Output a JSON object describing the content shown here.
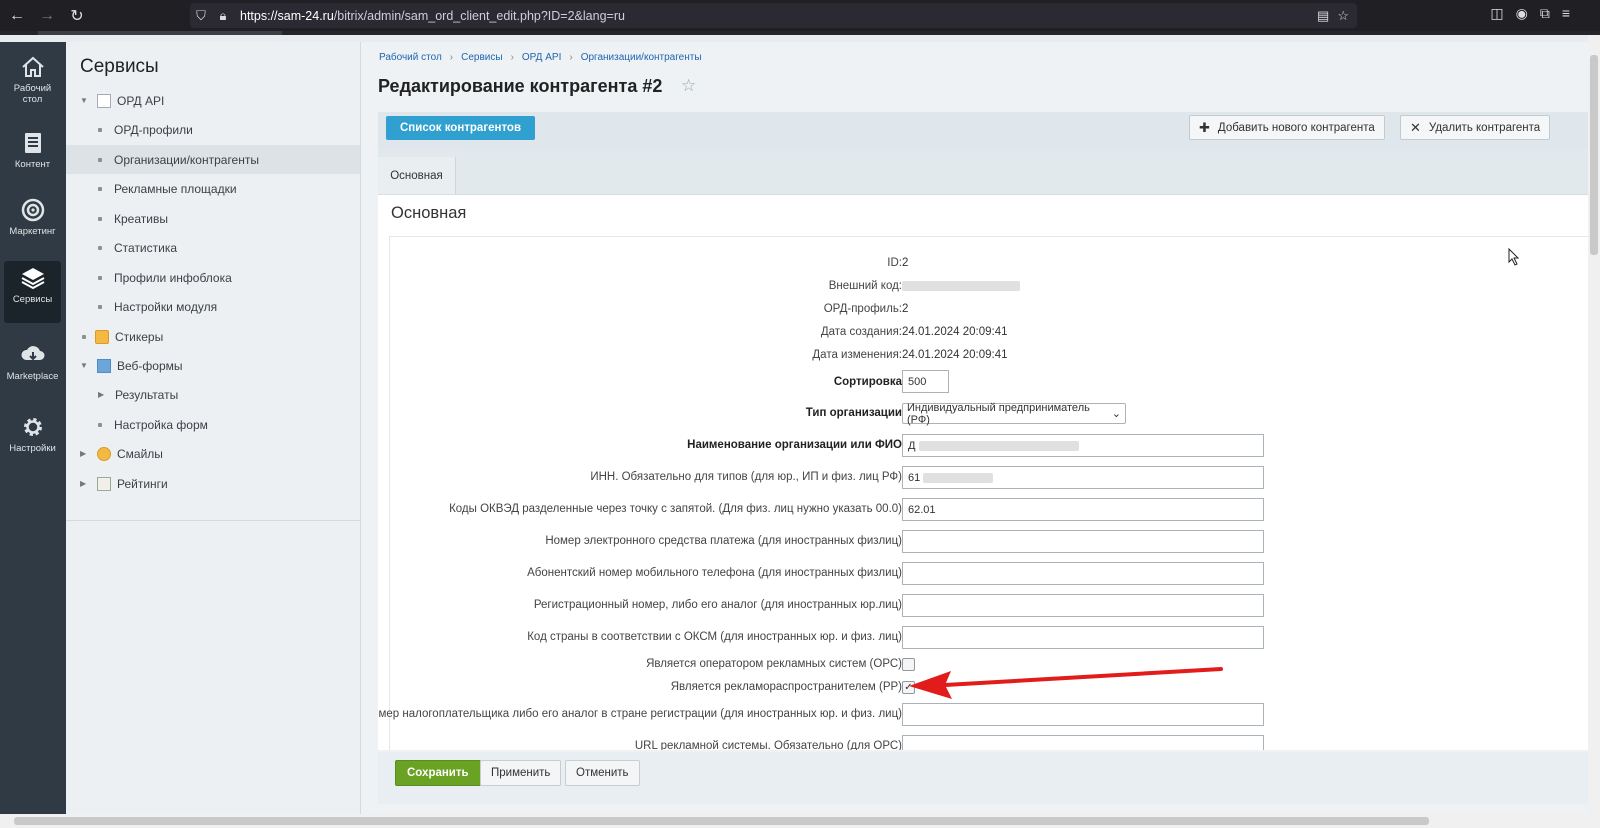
{
  "browser": {
    "url_host": "https://sam-24.ru",
    "url_path": "/bitrix/admin/sam_ord_client_edit.php?ID=2&lang=ru",
    "icons": [
      "back-icon",
      "forward-icon",
      "reload-icon",
      "shield-icon",
      "lock-icon",
      "reader-icon",
      "bookmark-star-icon",
      "pocket-icon",
      "account-icon",
      "extensions-icon",
      "menu-icon"
    ]
  },
  "leftnav": {
    "items": [
      {
        "label": "Рабочий стол",
        "icon": "home-icon"
      },
      {
        "label": "Контент",
        "icon": "content-icon"
      },
      {
        "label": "Маркетинг",
        "icon": "target-icon"
      },
      {
        "label": "Сервисы",
        "icon": "layers-icon"
      },
      {
        "label": "Marketplace",
        "icon": "cloud-download-icon"
      },
      {
        "label": "Настройки",
        "icon": "gear-icon"
      }
    ]
  },
  "sidebar": {
    "title": "Сервисы",
    "items": [
      {
        "label": "ОРД API"
      },
      {
        "label": "ОРД-профили"
      },
      {
        "label": "Организации/контрагенты"
      },
      {
        "label": "Рекламные площадки"
      },
      {
        "label": "Креативы"
      },
      {
        "label": "Статистика"
      },
      {
        "label": "Профили инфоблока"
      },
      {
        "label": "Настройки модуля"
      },
      {
        "label": "Стикеры"
      },
      {
        "label": "Веб-формы"
      },
      {
        "label": "Результаты"
      },
      {
        "label": "Настройка форм"
      },
      {
        "label": "Смайлы"
      },
      {
        "label": "Рейтинги"
      }
    ]
  },
  "breadcrumb": [
    "Рабочий стол",
    "Сервисы",
    "ОРД API",
    "Организации/контрагенты"
  ],
  "page": {
    "title": "Редактирование контрагента #2"
  },
  "toolbar": {
    "list_label": "Список контрагентов",
    "add_label": "Добавить нового контрагента",
    "delete_label": "Удалить контрагента"
  },
  "tabs": {
    "main": "Основная"
  },
  "form": {
    "section_title": "Основная",
    "id_label": "ID:",
    "id_value": "2",
    "ext_code_label": "Внешний код:",
    "ord_profile_label": "ОРД-профиль:",
    "ord_profile_value": "2",
    "created_label": "Дата создания:",
    "created_value": "24.01.2024 20:09:41",
    "modified_label": "Дата изменения:",
    "modified_value": "24.01.2024 20:09:41",
    "sort_label": "Сортировка",
    "sort_value": "500",
    "org_type_label": "Тип организации",
    "org_type_value": "Индивидуальный предприниматель (РФ)",
    "name_label": "Наименование организации или ФИО",
    "name_value": "Д",
    "inn_label": "ИНН. Обязательно для типов (для юр., ИП и физ. лиц РФ)",
    "inn_value": "61",
    "okved_label": "Коды ОКВЭД разделенные через точку с запятой. (Для физ. лиц нужно указать 00.0)",
    "okved_value": "62.01",
    "payment_label": "Номер электронного средства платежа (для иностранных физлиц)",
    "phone_label": "Абонентский номер мобильного телефона (для иностранных физлиц)",
    "reg_label": "Регистрационный номер, либо его аналог (для иностранных юр.лиц)",
    "country_label": "Код страны в соответствии с ОКСМ (для иностранных юр. и физ. лиц)",
    "ors_label": "Является оператором рекламных систем (ОРС)",
    "ors_checked": false,
    "rr_label": "Является рекламораспространителем (РР)",
    "rr_checked": true,
    "taxnum_label": "Номер налогоплательщика либо его аналог в стране регистрации (для иностранных юр. и физ. лиц)",
    "url_label": "URL рекламной системы. Обязательно (для ОРС)"
  },
  "footer": {
    "save": "Сохранить",
    "apply": "Применить",
    "cancel": "Отменить"
  },
  "colors": {
    "accent_blue": "#2fa0cf",
    "save_green": "#6aa223",
    "annotation_red": "#e21b1b"
  }
}
